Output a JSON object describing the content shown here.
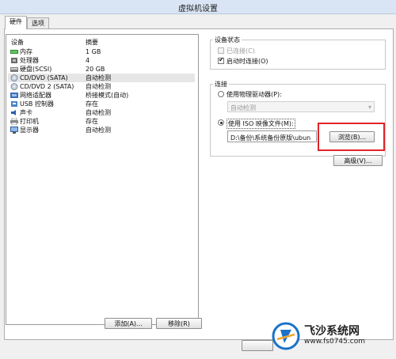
{
  "window": {
    "title": "虚拟机设置"
  },
  "tabs": [
    {
      "label": "硬件",
      "active": true
    },
    {
      "label": "选项",
      "active": false
    }
  ],
  "device_list": {
    "col_device": "设备",
    "col_summary": "摘要",
    "rows": [
      {
        "name": "内存",
        "summary": "1 GB",
        "icon": "memory-icon"
      },
      {
        "name": "处理器",
        "summary": "4",
        "icon": "processor-icon"
      },
      {
        "name": "硬盘(SCSI)",
        "summary": "20 GB",
        "icon": "hard-disk-icon"
      },
      {
        "name": "CD/DVD (SATA)",
        "summary": "自动检测",
        "icon": "cd-dvd-icon",
        "selected": true
      },
      {
        "name": "CD/DVD 2 (SATA)",
        "summary": "自动检测",
        "icon": "cd-dvd-icon"
      },
      {
        "name": "网络适配器",
        "summary": "桥接模式(自动)",
        "icon": "network-adapter-icon"
      },
      {
        "name": "USB 控制器",
        "summary": "存在",
        "icon": "usb-icon"
      },
      {
        "name": "声卡",
        "summary": "自动检测",
        "icon": "sound-card-icon"
      },
      {
        "name": "打印机",
        "summary": "存在",
        "icon": "printer-icon"
      },
      {
        "name": "显示器",
        "summary": "自动检测",
        "icon": "monitor-icon"
      }
    ],
    "add_button": "添加(A)...",
    "remove_button": "移除(R)"
  },
  "device_status": {
    "title": "设备状态",
    "connected": {
      "label": "已连接(C)",
      "checked": false,
      "disabled": true
    },
    "connect_at_power_on": {
      "label": "启动时连接(O)",
      "checked": true
    }
  },
  "connection": {
    "title": "连接",
    "physical_drive": {
      "label": "使用物理驱动器(P):",
      "selected": false
    },
    "physical_drive_value": "自动检测",
    "iso_image": {
      "label": "使用 ISO 映像文件(M):",
      "selected": true
    },
    "iso_path": "D:\\备份\\系统备份原版\\ubun",
    "browse_button": "浏览(B)...",
    "advanced_button": "高级(V)..."
  },
  "watermark": {
    "brand": "飞沙系统网",
    "url": "www.fs0745.com"
  },
  "colors": {
    "highlight": "#e2232a",
    "watermark_blue": "#1a73c9"
  }
}
